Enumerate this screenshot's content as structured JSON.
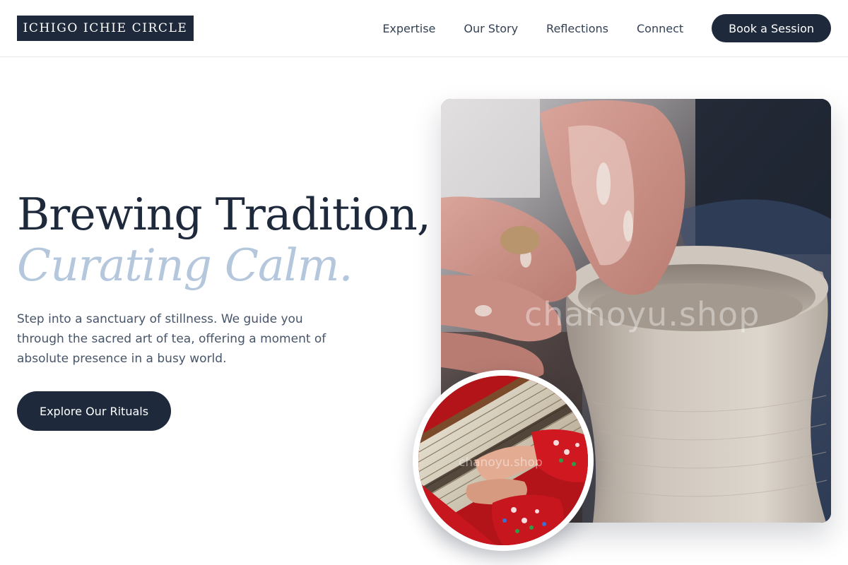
{
  "brand": {
    "name": "ICHIGO ICHIE CIRCLE"
  },
  "nav": {
    "items": [
      {
        "label": "Expertise"
      },
      {
        "label": "Our Story"
      },
      {
        "label": "Reflections"
      },
      {
        "label": "Connect"
      }
    ],
    "cta_label": "Book a Session"
  },
  "hero": {
    "title_line1": "Brewing Tradition,",
    "title_line2": "Curating Calm.",
    "description": "Step into a sanctuary of stillness. We guide you through the sacred art of tea, offering a moment of absolute presence in a busy world.",
    "button_label": "Explore Our Rituals"
  },
  "images": {
    "main_watermark": "chanoyu.shop",
    "circle_watermark": "chanoyu.shop"
  },
  "colors": {
    "primary": "#1e293b",
    "accent": "#b4c7dc",
    "body_text": "#475569"
  }
}
